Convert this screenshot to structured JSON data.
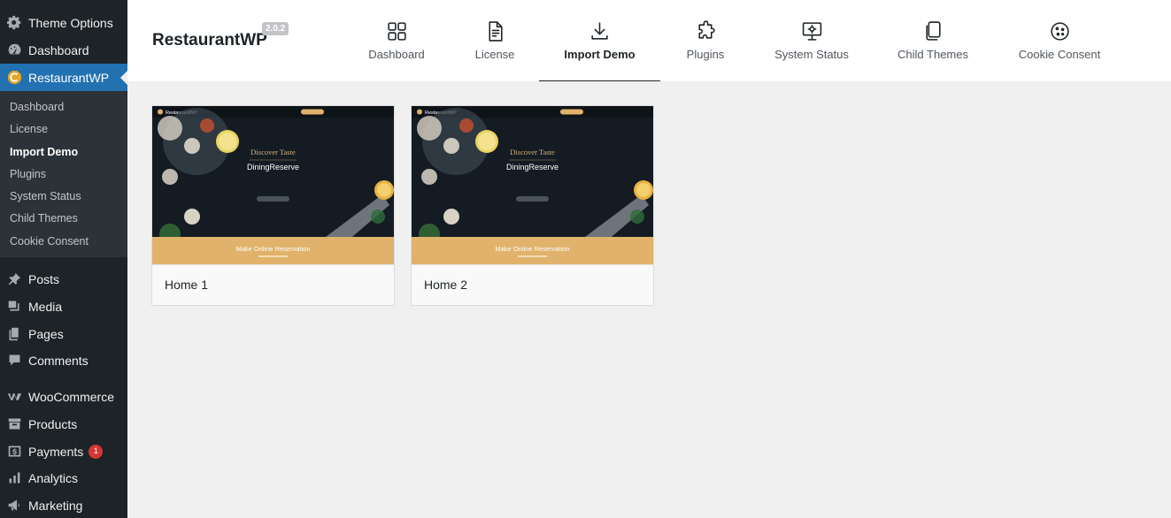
{
  "sidebar": {
    "theme_options": "Theme Options",
    "dashboard": "Dashboard",
    "restaurantwp": "RestaurantWP",
    "submenu": [
      "Dashboard",
      "License",
      "Import Demo",
      "Plugins",
      "System Status",
      "Child Themes",
      "Cookie Consent"
    ],
    "posts": "Posts",
    "media": "Media",
    "pages": "Pages",
    "comments": "Comments",
    "woocommerce": "WooCommerce",
    "products": "Products",
    "payments": "Payments",
    "payments_badge": "1",
    "analytics": "Analytics",
    "marketing": "Marketing"
  },
  "header": {
    "brand": "RestaurantWP",
    "version": "2.0.2",
    "tabs": [
      {
        "label": "Dashboard",
        "icon": "grid-icon"
      },
      {
        "label": "License",
        "icon": "document-icon"
      },
      {
        "label": "Import Demo",
        "icon": "download-icon",
        "active": true
      },
      {
        "label": "Plugins",
        "icon": "puzzle-icon"
      },
      {
        "label": "System Status",
        "icon": "monitor-gear-icon"
      },
      {
        "label": "Child Themes",
        "icon": "copy-icon"
      },
      {
        "label": "Cookie Consent",
        "icon": "cookie-icon"
      }
    ]
  },
  "demos": [
    {
      "name": "Home 1"
    },
    {
      "name": "Home 2"
    }
  ],
  "demo_preview": {
    "logo": "RestaurantWP",
    "hero_script": "Discover Taste",
    "hero_title": "DiningReserve",
    "cta_bar": "Make Online Reservation"
  },
  "colors": {
    "sidebar_bg": "#1d2327",
    "submenu_bg": "#2c3338",
    "accent": "#2271b1",
    "reservation_bar": "#e0b26b",
    "badge": "#d63638"
  }
}
